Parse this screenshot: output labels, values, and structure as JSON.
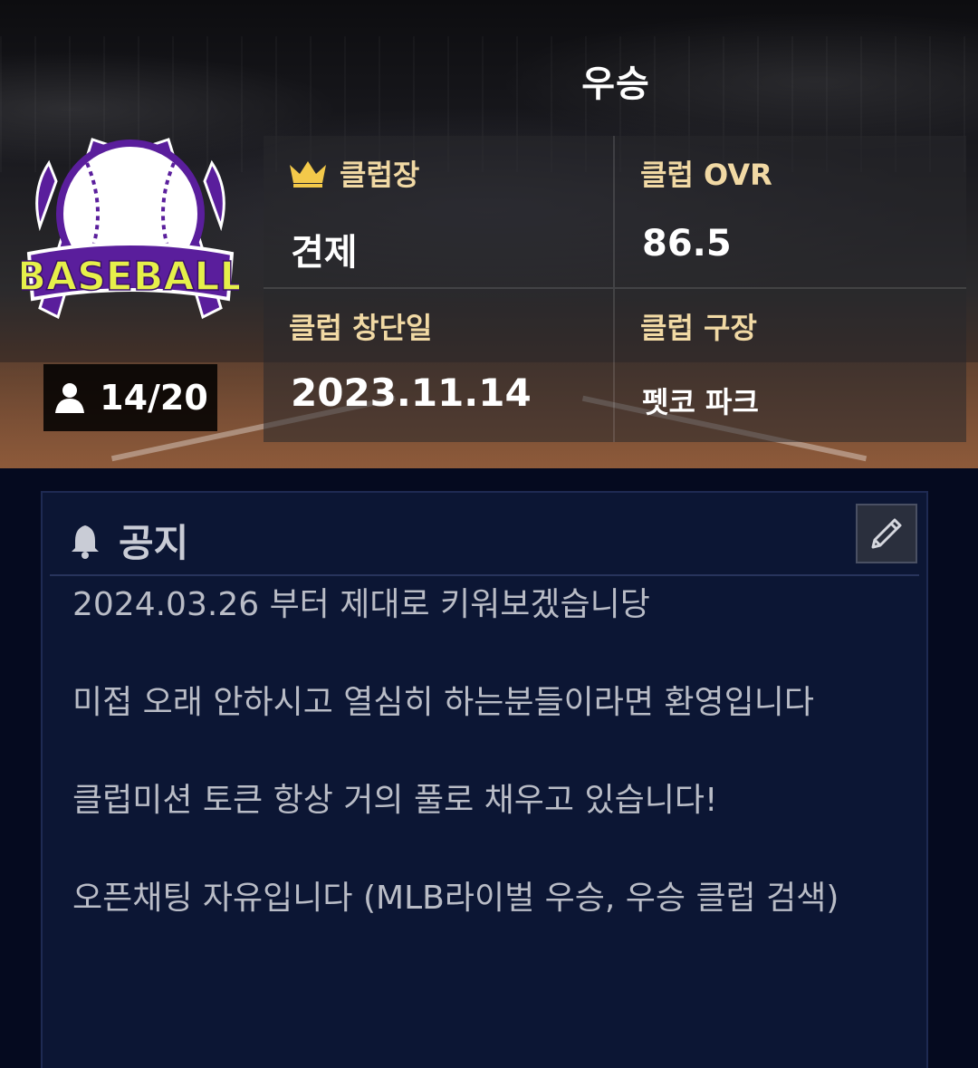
{
  "club": {
    "name": "우승",
    "logo_text": "BASEBALL",
    "member_count": "14/20"
  },
  "info": {
    "leader_label": "클럽장",
    "leader_value": "견제",
    "ovr_label": "클럽 OVR",
    "ovr_value": "86.5",
    "founded_label": "클럽 창단일",
    "founded_value": "2023.11.14",
    "stadium_label": "클럽 구장",
    "stadium_value": "펫코 파크"
  },
  "notice": {
    "title": "공지",
    "lines": [
      "2024.03.26 부터 제대로 키워보겠습니당",
      "미접 오래 안하시고 열심히 하는분들이라면 환영입니다",
      "클럽미션 토큰 항상 거의 풀로 채우고 있습니다!",
      "오픈채팅 자유입니다 (MLB라이벌 우승, 우승 클럽 검색)"
    ]
  },
  "icons": {
    "crown": "crown-icon",
    "person": "person-icon",
    "bell": "bell-icon",
    "edit": "pencil-icon"
  },
  "colors": {
    "label_gold": "#f1d9a4",
    "logo_purple": "#5a1e9c",
    "logo_yellow": "#e6f04a",
    "notice_bg": "#0c1634"
  }
}
